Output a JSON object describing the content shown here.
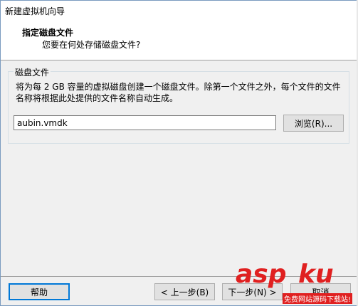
{
  "window": {
    "title": "新建虚拟机向导"
  },
  "header": {
    "title": "指定磁盘文件",
    "subtitle": "您要在何处存储磁盘文件?"
  },
  "disk_group": {
    "legend": "磁盘文件",
    "description": "将为每 2 GB 容量的虚拟磁盘创建一个磁盘文件。除第一个文件之外，每个文件的文件名称将根据此处提供的文件名称自动生成。",
    "file_value": "aubin.vmdk",
    "browse_label": "浏览(R)..."
  },
  "footer": {
    "help_label": "帮助",
    "back_label": "< 上一步(B)",
    "next_label": "下一步(N) >",
    "cancel_label": "取消"
  },
  "watermark": {
    "asp": "asp",
    "ku": "ku",
    "sub": "免费网站源码下载站!"
  },
  "colors": {
    "accent": "#0078d7",
    "watermark": "#e02020"
  }
}
